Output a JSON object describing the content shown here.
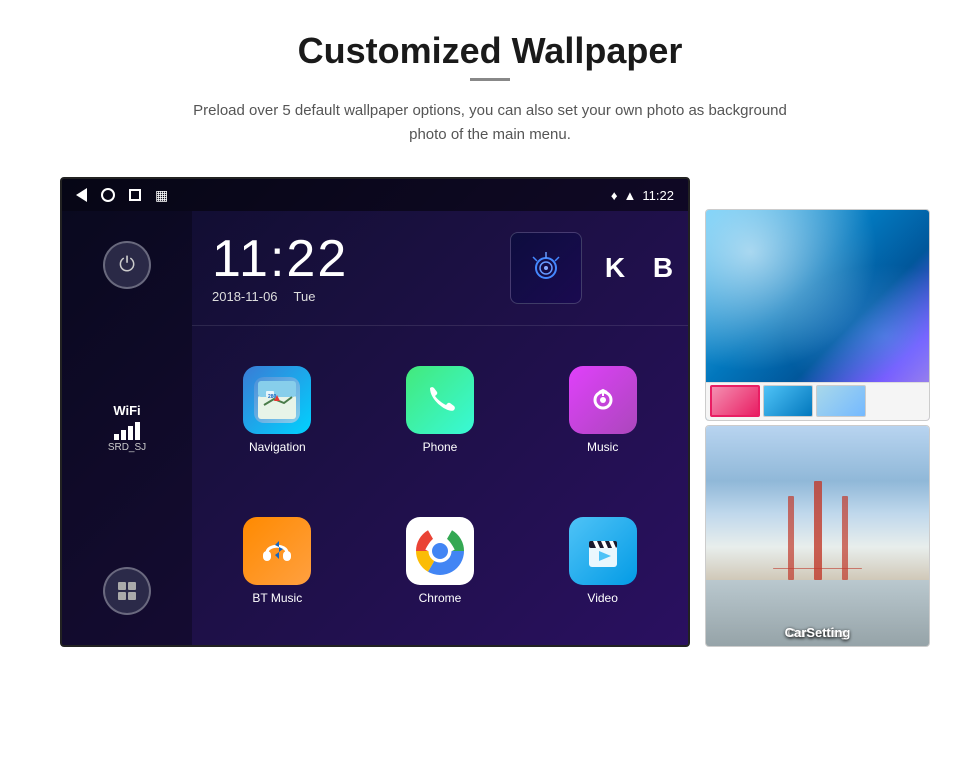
{
  "page": {
    "title": "Customized Wallpaper",
    "subtitle": "Preload over 5 default wallpaper options, you can also set your own photo as background photo of the main menu.",
    "divider": "—"
  },
  "statusBar": {
    "time": "11:22",
    "icons": {
      "location": "♦",
      "wifi": "▲",
      "signal": "▲"
    }
  },
  "clock": {
    "time": "11:22",
    "date": "2018-11-06",
    "day": "Tue"
  },
  "wifi": {
    "label": "WiFi",
    "ssid": "SRD_SJ"
  },
  "apps": [
    {
      "name": "Navigation",
      "icon": "🗺",
      "type": "navigation"
    },
    {
      "name": "Phone",
      "icon": "📞",
      "type": "phone"
    },
    {
      "name": "Music",
      "icon": "🎵",
      "type": "music"
    },
    {
      "name": "BT Music",
      "icon": "🎧",
      "type": "btmusic"
    },
    {
      "name": "Chrome",
      "icon": "chrome",
      "type": "chrome"
    },
    {
      "name": "Video",
      "icon": "🎬",
      "type": "video"
    }
  ],
  "wallpapers": {
    "thumb1_label": "",
    "thumb2_label": "CarSetting"
  },
  "sidebar": {
    "powerIcon": "⏻",
    "appsIcon": "⊞"
  }
}
